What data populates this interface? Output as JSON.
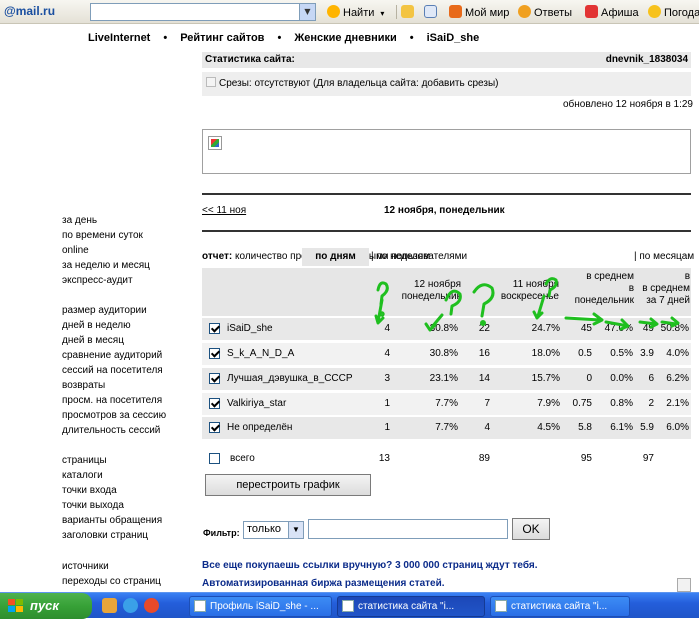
{
  "toolbar": {
    "logo": "@mail.ru",
    "search_button": "Найти",
    "items": [
      "Мой мир",
      "Ответы",
      "Афиша",
      "Погода"
    ]
  },
  "breadcrumbs": [
    "LiveInternet",
    "Рейтинг сайтов",
    "Женские дневники",
    "iSaiD_she"
  ],
  "stats": {
    "header_label": "Статистика сайта:",
    "site_id": "dnevnik_1838034",
    "srezy_text": "Срезы: отсутствуют (Для владельца сайта: добавить срезы)",
    "updated": "обновлено 12 ноября в 1:29",
    "prev_day": "<< 11 ноя",
    "current_day": "12 ноября, понедельник"
  },
  "leftnav": {
    "group1": [
      "за день",
      "по времени суток",
      "online",
      "за неделю и месяц",
      "экспресс-аудит"
    ],
    "group2": [
      "размер аудитории",
      "дней в неделю",
      "дней в месяц",
      "сравнение аудиторий",
      "сессий на посетителя",
      "возвраты",
      "просм. на посетителя",
      "просмотров за сессию",
      "длительность сессий"
    ],
    "group3": [
      "страницы",
      "каталоги",
      "точки входа",
      "точки выхода",
      "варианты обращения",
      "заголовки страниц"
    ],
    "group4": [
      "источники",
      "переходы со страниц"
    ]
  },
  "report": {
    "label": "отчет:",
    "description": "количество просмотров разными пользователями",
    "tab_days": "по дням",
    "tab_weeks": "| по неделям",
    "tab_months": "| по месяцам"
  },
  "table": {
    "headers": {
      "d12_line1": "12 ноября",
      "d12_line2": "понедельник",
      "d11_line1": "11 ноября",
      "d11_line2": "воскресенье",
      "avg_mon_1": "в среднем",
      "avg_mon_2": "в",
      "avg_mon_3": "понедельник",
      "avg7_1": "в",
      "avg7_2": "в среднем",
      "avg7_3": "за 7 дней"
    },
    "rows": [
      {
        "name": "iSaiD_she",
        "v12": "4",
        "p12": "30.8%",
        "v11": "22",
        "p11": "24.7%",
        "vm": "45",
        "pm": "47.0%",
        "v7": "49",
        "p7": "50.8%",
        "checked": true
      },
      {
        "name": "S_k_A_N_D_A",
        "v12": "4",
        "p12": "30.8%",
        "v11": "16",
        "p11": "18.0%",
        "vm": "0.5",
        "pm": "0.5%",
        "v7": "3.9",
        "p7": "4.0%",
        "checked": true
      },
      {
        "name": "Лучшая_дэвушка_в_СССР",
        "v12": "3",
        "p12": "23.1%",
        "v11": "14",
        "p11": "15.7%",
        "vm": "0",
        "pm": "0.0%",
        "v7": "6",
        "p7": "6.2%",
        "checked": true
      },
      {
        "name": "Valkiriya_star",
        "v12": "1",
        "p12": "7.7%",
        "v11": "7",
        "p11": "7.9%",
        "vm": "0.75",
        "pm": "0.8%",
        "v7": "2",
        "p7": "2.1%",
        "checked": true
      },
      {
        "name": "Не определён",
        "v12": "1",
        "p12": "7.7%",
        "v11": "4",
        "p11": "4.5%",
        "vm": "5.8",
        "pm": "6.1%",
        "v7": "5.9",
        "p7": "6.0%",
        "checked": true
      }
    ],
    "total": {
      "name": "всего",
      "v12": "13",
      "v11": "89",
      "vm": "95",
      "v7": "97",
      "checked": false
    }
  },
  "rebuild_button": "перестроить график",
  "filter": {
    "label": "Фильтр:",
    "mode": "только",
    "value": "",
    "ok": "OK"
  },
  "ads": {
    "line1": "Все еще покупаешь ссылки вручную? 3 000 000 страниц ждут тебя.",
    "line2": "Автоматизированная биржа размещения статей."
  },
  "taskbar": {
    "start": "пуск",
    "tasks": [
      "Профиль iSaiD_she - ...",
      "статистика сайта \"i...",
      "статистика сайта \"i..."
    ]
  },
  "colors": {
    "annotation_green": "#1fbf1f",
    "link_blue": "#0b2b8a",
    "taskbar_blue": "#245edb",
    "start_green": "#37a137"
  }
}
